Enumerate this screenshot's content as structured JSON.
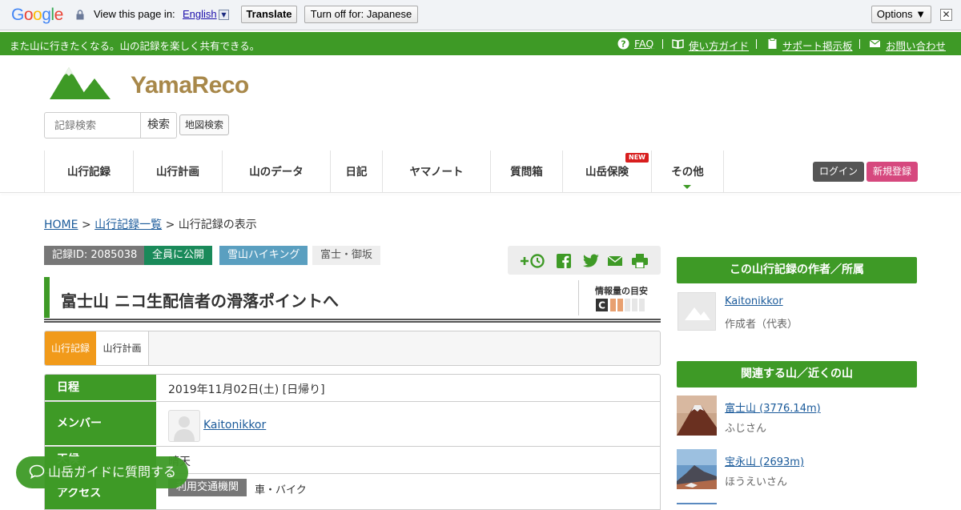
{
  "translate_bar": {
    "logo": "Google",
    "view_text": "View this page in:",
    "language": "English",
    "translate_label": "Translate",
    "turn_off_label": "Turn off for: Japanese",
    "options_label": "Options ▼",
    "close_glyph": "✕"
  },
  "top_strip": {
    "tagline": "また山に行きたくなる。山の記録を楽しく共有できる。",
    "links": [
      {
        "label": "FAQ",
        "icon": "question-icon"
      },
      {
        "label": "使い方ガイド",
        "icon": "book-icon"
      },
      {
        "label": "サポート掲示板",
        "icon": "clipboard-icon"
      },
      {
        "label": "お問い合わせ",
        "icon": "mail-icon"
      }
    ]
  },
  "header": {
    "logo_text": "YamaReco",
    "search_placeholder": "記録検索",
    "search_label": "検索",
    "map_search_label": "地図検索"
  },
  "nav": {
    "items": [
      {
        "label": "山行記録"
      },
      {
        "label": "山行計画"
      },
      {
        "label": "山のデータ"
      },
      {
        "label": "日記"
      },
      {
        "label": "ヤマノート"
      },
      {
        "label": "質問箱"
      },
      {
        "label": "山岳保険",
        "badge": "NEW"
      },
      {
        "label": "その他"
      }
    ],
    "login_label": "ログイン",
    "register_label": "新規登録"
  },
  "breadcrumb": {
    "home": "HOME",
    "sep": ">",
    "list": "山行記録一覧",
    "current": "山行記録の表示"
  },
  "record": {
    "id_badge": "記録ID: 2085038",
    "visibility": "全員に公開",
    "type": "雪山ハイキング",
    "area": "富士・御坂",
    "title": "富士山 ニコ生配信者の滑落ポイントへ",
    "info_label": "情報量の目安",
    "info_grade": "C",
    "info_level": 2,
    "tabs": {
      "active": "山行記録",
      "other": "山行計画"
    },
    "colors": {
      "green": "#3e9a26",
      "orange": "#f19a1a",
      "badge_gray": "#777777",
      "type_blue": "#5a9fc0"
    }
  },
  "details": {
    "schedule_label": "日程",
    "schedule_value": "2019年11月02日(土) [日帰り]",
    "member_label": "メンバー",
    "member_name": "Kaitonikkor",
    "weather_label": "天候",
    "weather_value": "晴天",
    "transit_label": "アクセス",
    "transit_tag": "利用交通機関",
    "transit_value": "車・バイク"
  },
  "guide_button": {
    "label": "山岳ガイドに質問する"
  },
  "sidebar": {
    "author_heading": "この山行記録の作者／所属",
    "author_name": "Kaitonikkor",
    "author_role": "作成者（代表）",
    "related_heading": "関連する山／近くの山",
    "mountains": [
      {
        "name": "富士山 (3776.14m)",
        "reading": "ふじさん"
      },
      {
        "name": "宝永山 (2693m)",
        "reading": "ほうえいさん"
      }
    ]
  }
}
